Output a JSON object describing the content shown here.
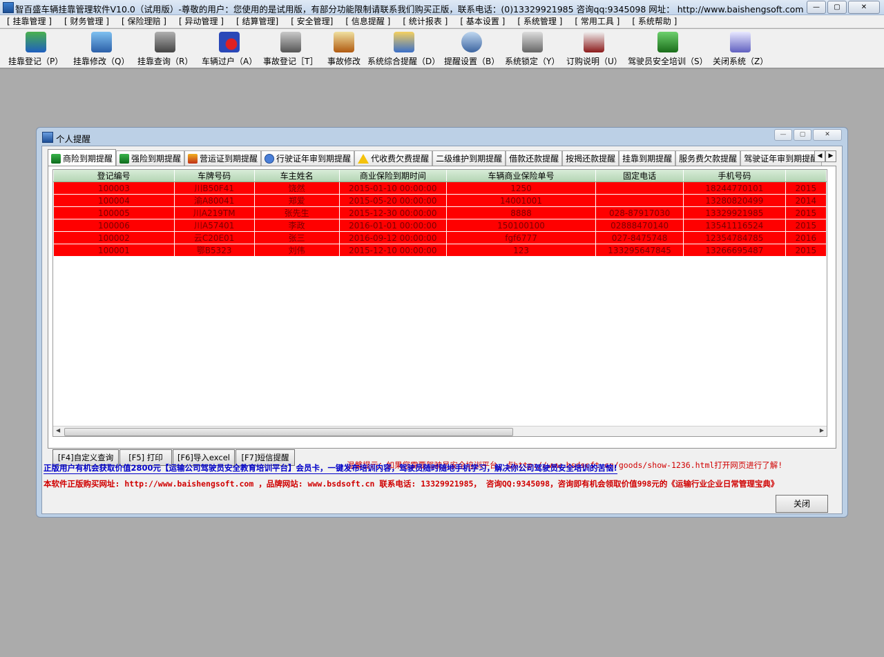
{
  "app": {
    "title": "智百盛车辆挂靠管理软件V10.0（试用版）-尊敬的用户：您使用的是试用版，有部分功能限制请联系我们购买正版，联系电话：(0)13329921985  咨询qq:9345098   网址： http://www.baishengsoft.com",
    "window_buttons": [
      "—",
      "▢",
      "✕"
    ]
  },
  "menu": [
    "[ 挂靠管理 ]",
    "[ 财务管理 ]",
    "[ 保险理赔 ]",
    "[ 异动管理 ]",
    "[ 结算管理]",
    "[ 安全管理]",
    "[ 信息提醒 ]",
    "[ 统计报表 ]",
    "[ 基本设置 ]",
    "[ 系统管理 ]",
    "[ 常用工具 ]",
    "[ 系统帮助 ]"
  ],
  "toolbar": [
    {
      "label": "挂靠登记（P）",
      "icon": "register-icon"
    },
    {
      "label": "挂靠修改（Q）",
      "icon": "edit-icon"
    },
    {
      "label": "挂靠查询（R）",
      "icon": "query-icon"
    },
    {
      "label": "车辆过户（A）",
      "icon": "transfer-icon"
    },
    {
      "label": "事故登记［T］",
      "icon": "accident-register-icon"
    },
    {
      "label": "事故修改",
      "icon": "accident-edit-icon"
    },
    {
      "label": "系统综合提醒（D）",
      "icon": "reminder-icon"
    },
    {
      "label": "提醒设置（B）",
      "icon": "reminder-settings-icon"
    },
    {
      "label": "系统锁定（Y）",
      "icon": "lock-icon"
    },
    {
      "label": "订购说明（U）",
      "icon": "book-icon"
    },
    {
      "label": "驾驶员安全培训（S）",
      "icon": "training-icon"
    },
    {
      "label": "关闭系统（Z）",
      "icon": "shutdown-icon"
    }
  ],
  "dialog": {
    "title": "个人提醒",
    "controls": [
      "—",
      "▢",
      "✕"
    ],
    "tabs": [
      "商险到期提醒",
      "强险到期提醒",
      "营运证到期提醒",
      "行驶证年审到期提醒",
      "代收费欠费提醒",
      "二级维护到期提醒",
      "借款还款提醒",
      "按揭还款提醒",
      "挂靠到期提醒",
      "服务费欠款提醒",
      "驾驶证年审到期提醒"
    ],
    "tab_scroll": [
      "◀",
      "▶"
    ],
    "columns": [
      "登记编号",
      "车牌号码",
      "车主姓名",
      "商业保险到期时间",
      "车辆商业保险单号",
      "固定电话",
      "手机号码",
      ""
    ],
    "rows": [
      [
        "100003",
        "川B50F41",
        "饶然",
        "2015-01-10 00:00:00",
        "1250",
        "",
        "18244770101",
        "2015"
      ],
      [
        "100004",
        "渝A80041",
        "郑爱",
        "2015-05-20 00:00:00",
        "14001001",
        "",
        "13280820499",
        "2014"
      ],
      [
        "100005",
        "川A219TM",
        "张先生",
        "2015-12-30 00:00:00",
        "8888",
        "028-87917030",
        "13329921985",
        "2015"
      ],
      [
        "100006",
        "川A57401",
        "李政",
        "2016-01-01 00:00:00",
        "150100100",
        "02888470140",
        "13541116524",
        "2015"
      ],
      [
        "100002",
        "云C20E01",
        "张三",
        "2016-09-12 00:00:00",
        "fgf6777",
        "027-8475748",
        "12354784785",
        "2016"
      ],
      [
        "100001",
        "鄂B5323",
        "刘伟",
        "2015-12-10 00:00:00",
        "123",
        "133295647845",
        "13266695487",
        "2015"
      ]
    ],
    "buttons": [
      "[F4]自定义查询",
      "[F5] 打印",
      "[F6]导入excel",
      "[F7]短信提醒"
    ],
    "hint": "温馨提示：如果您需要驾驶员安全培训平台，点http://www.bsdsoft.cn/goods/show-1236.html打开网页进行了解!",
    "promo1": "正版用户有机会获取价值2800元【运输公司驾驶员安全教育培训平台】会员卡，一键发布培训内容，驾驶员随时随地手机学习，解决你公司驾驶员安全培训的苦恼!",
    "promo2": "本软件正版购买网址: http://www.baishengsoft.com ，品牌网站: www.bsdsoft.cn  联系电话: 13329921985， 咨询QQ:9345098，咨询即有机会领取价值998元的《运输行业企业日常管理宝典》",
    "close_label": "关闭"
  }
}
